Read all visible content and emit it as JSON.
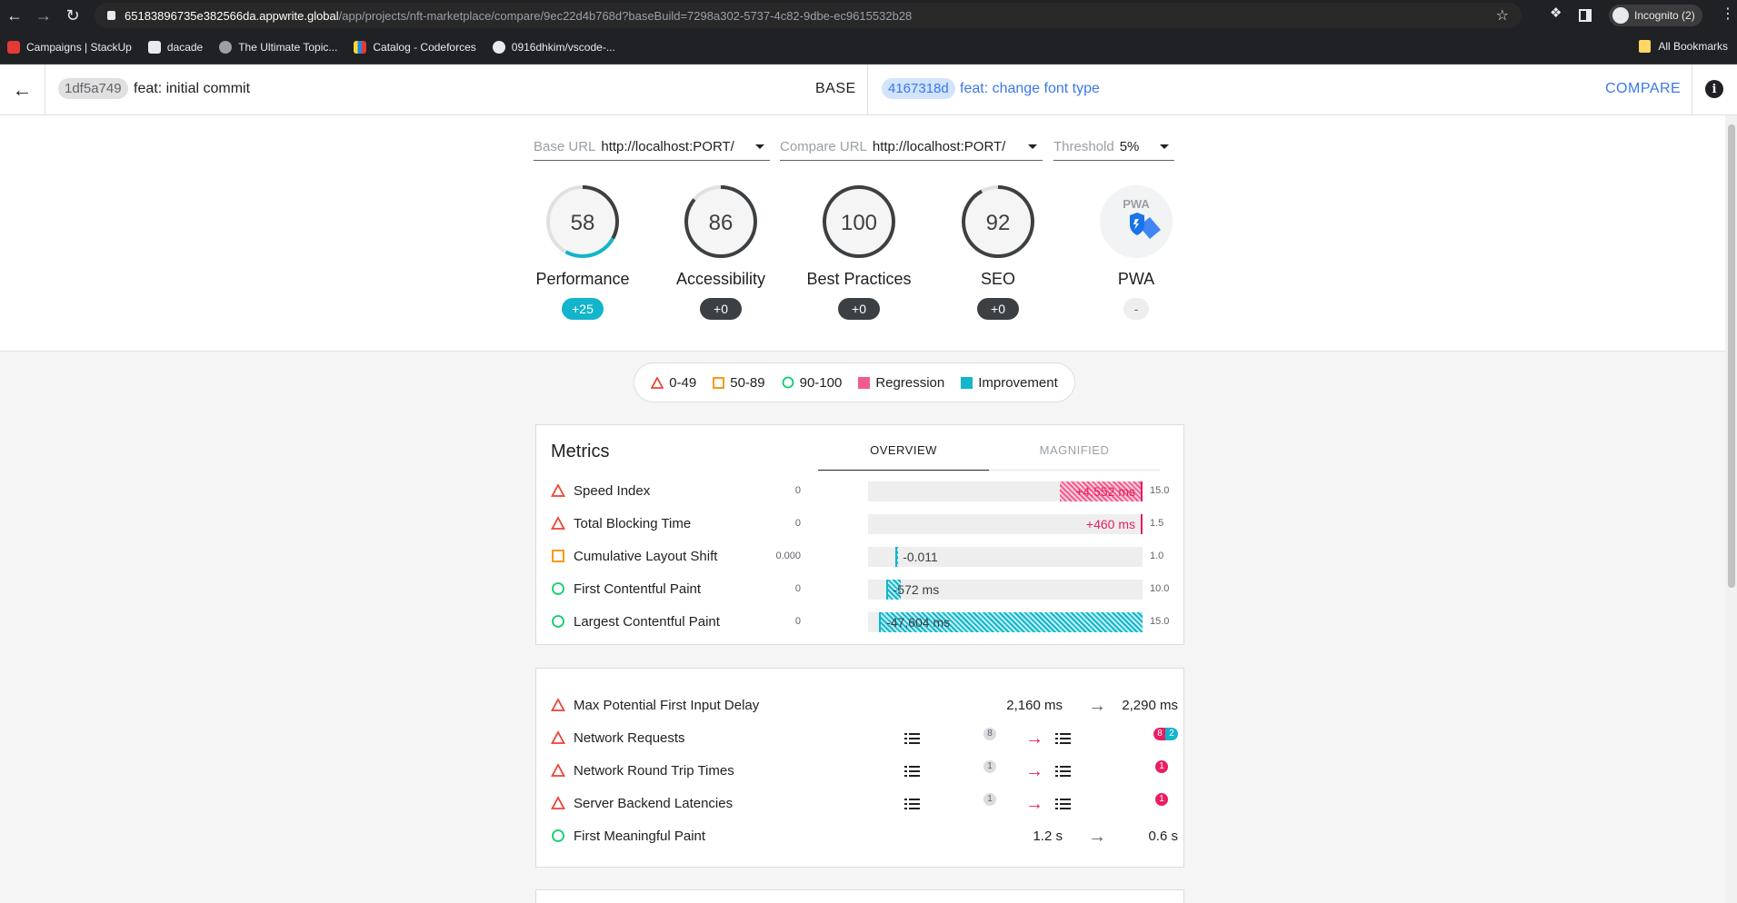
{
  "browser": {
    "url_host": "65183896735e382566da.appwrite.global",
    "url_path": "/app/projects/nft-marketplace/compare/9ec22d4b768d?baseBuild=7298a302-5737-4c82-9dbe-ec9615532b28",
    "incognito_label": "Incognito (2)",
    "bookmarks": [
      {
        "label": "Campaigns | StackUp",
        "color": "#e53935"
      },
      {
        "label": "dacade",
        "color": "#e8eaed"
      },
      {
        "label": "The Ultimate Topic...",
        "color": "#9aa0a6"
      },
      {
        "label": "Catalog - Codeforces",
        "color": "#1e88e5"
      },
      {
        "label": "0916dhkim/vscode-...",
        "color": "#e8eaed"
      }
    ],
    "all_bookmarks": "All Bookmarks"
  },
  "header": {
    "base_hash": "1df5a749",
    "base_message": "feat: initial commit",
    "base_label": "BASE",
    "compare_hash": "4167318d",
    "compare_message": "feat: change font type",
    "compare_button": "COMPARE"
  },
  "filters": {
    "base_url": {
      "label": "Base URL",
      "value": "http://localhost:PORT/"
    },
    "compare_url": {
      "label": "Compare URL",
      "value": "http://localhost:PORT/"
    },
    "threshold": {
      "label": "Threshold",
      "value": "5%"
    }
  },
  "gauges": [
    {
      "name": "Performance",
      "score": "58",
      "fraction": 0.58,
      "delta": "+25",
      "delta_kind": "imp",
      "improvement_fraction": 0.25
    },
    {
      "name": "Accessibility",
      "score": "86",
      "fraction": 0.86,
      "delta": "+0",
      "delta_kind": "neutral"
    },
    {
      "name": "Best Practices",
      "score": "100",
      "fraction": 1.0,
      "delta": "+0",
      "delta_kind": "neutral"
    },
    {
      "name": "SEO",
      "score": "92",
      "fraction": 0.92,
      "delta": "+0",
      "delta_kind": "neutral"
    },
    {
      "name": "PWA",
      "score": "PWA",
      "delta": "-",
      "delta_kind": "none"
    }
  ],
  "legend": {
    "poor": "0-49",
    "average": "50-89",
    "good": "90-100",
    "regression": "Regression",
    "improvement": "Improvement",
    "colors": {
      "poor": "#eb4335",
      "average": "#fb8c00",
      "good": "#0cce6b",
      "regression": "#e91e63",
      "improvement": "#12b5cb"
    }
  },
  "metrics": {
    "title": "Metrics",
    "tabs": [
      "OVERVIEW",
      "MAGNIFIED"
    ],
    "rows": [
      {
        "label": "Speed Index",
        "status": "poor",
        "min": "0",
        "max": "15.0",
        "delta_text": "+4,552 ms",
        "kind": "reg",
        "base_fraction": 0.7,
        "compare_fraction": 1.0
      },
      {
        "label": "Total Blocking Time",
        "status": "poor",
        "min": "0",
        "max": "1.5",
        "delta_text": "+460 ms",
        "kind": "reg",
        "base_fraction": 1.0,
        "compare_fraction": 1.0
      },
      {
        "label": "Cumulative Layout Shift",
        "status": "average",
        "min": "0.000",
        "max": "1.0",
        "delta_text": "-0.011",
        "kind": "imp",
        "base_fraction": 0.11,
        "compare_fraction": 0.1
      },
      {
        "label": "First Contentful Paint",
        "status": "good",
        "min": "0",
        "max": "10.0",
        "delta_text": "-572 ms",
        "kind": "imp",
        "base_fraction": 0.12,
        "compare_fraction": 0.065
      },
      {
        "label": "Largest Contentful Paint",
        "status": "good",
        "min": "0",
        "max": "15.0",
        "delta_text": "-47,604 ms",
        "kind": "imp",
        "base_fraction": 1.0,
        "compare_fraction": 0.04
      }
    ]
  },
  "audits": [
    {
      "label": "Max Potential First Input Delay",
      "status": "poor",
      "from": "2,160 ms",
      "to": "2,290 ms"
    },
    {
      "label": "Network Requests",
      "status": "poor",
      "base_count": "8",
      "compare_counts": [
        "8",
        "2"
      ]
    },
    {
      "label": "Network Round Trip Times",
      "status": "poor",
      "base_count": "1",
      "compare_counts": [
        "1"
      ]
    },
    {
      "label": "Server Backend Latencies",
      "status": "poor",
      "base_count": "1",
      "compare_counts": [
        "1"
      ]
    },
    {
      "label": "First Meaningful Paint",
      "status": "good",
      "from": "1.2 s",
      "to": "0.6 s"
    }
  ]
}
